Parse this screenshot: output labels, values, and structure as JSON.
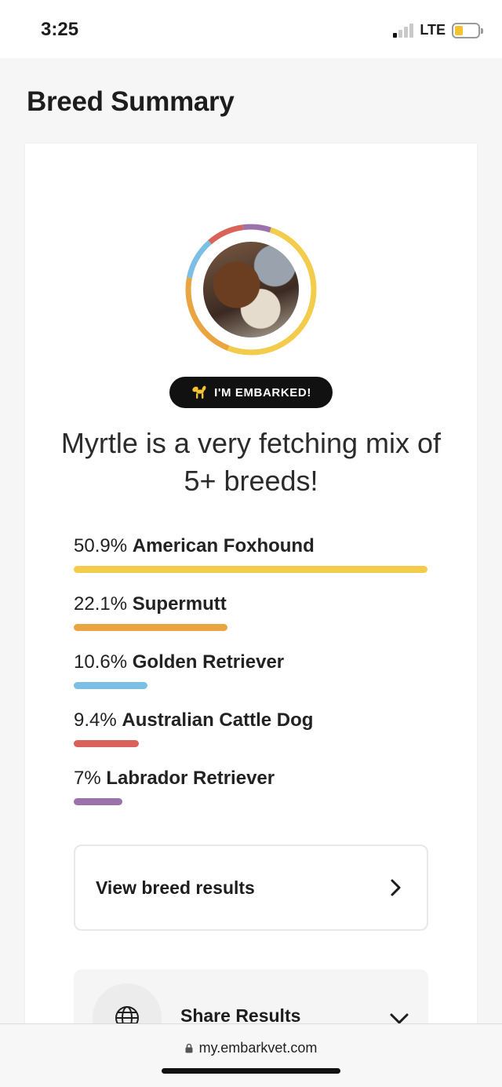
{
  "status": {
    "time": "3:25",
    "network": "LTE",
    "battery_level": 0.35,
    "battery_color": "#f4c430",
    "signal_bars_active": 1
  },
  "page": {
    "title": "Breed Summary"
  },
  "dog": {
    "badge_label": "I'M EMBARKED!",
    "badge_icon": "balloon-dog-icon",
    "headline": "Myrtle is a very fetching mix of 5+ breeds!"
  },
  "breeds": [
    {
      "percent": "50.9%",
      "name": "American Foxhound",
      "value": 50.9,
      "color": "#f2cc4a"
    },
    {
      "percent": "22.1%",
      "name": "Supermutt",
      "value": 22.1,
      "color": "#e8a542"
    },
    {
      "percent": "10.6%",
      "name": "Golden Retriever",
      "value": 10.6,
      "color": "#7cbfe5"
    },
    {
      "percent": "9.4%",
      "name": "Australian Cattle Dog",
      "value": 9.4,
      "color": "#d9625b"
    },
    {
      "percent": "7%",
      "name": "Labrador Retriever",
      "value": 7,
      "color": "#9b72ac"
    }
  ],
  "actions": {
    "view_breed_results": "View breed results",
    "share_results": "Share Results",
    "share_icon": "globe-icon"
  },
  "browser": {
    "url": "my.embarkvet.com"
  }
}
